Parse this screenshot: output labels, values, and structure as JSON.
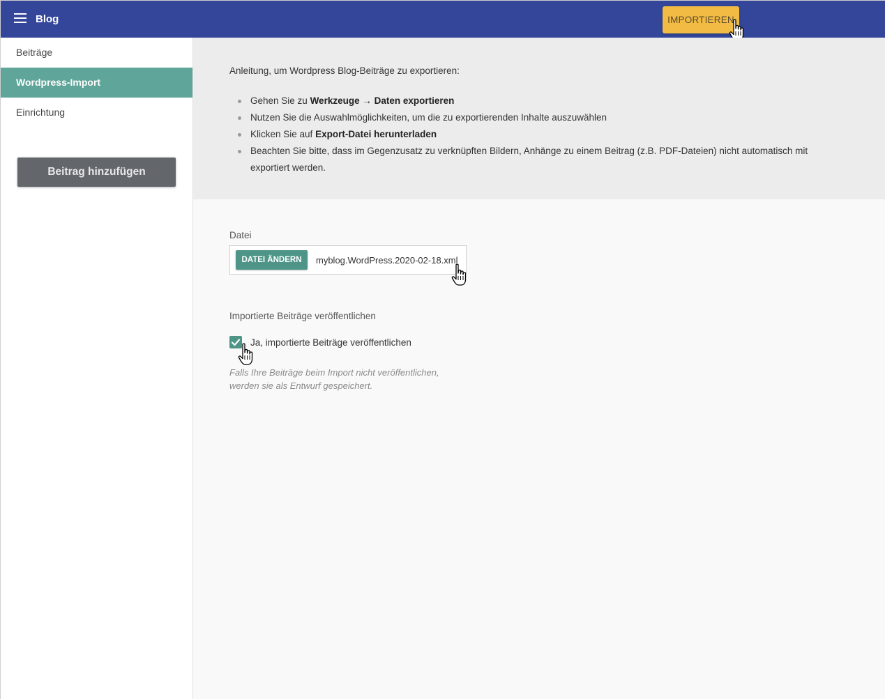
{
  "header": {
    "title": "Blog",
    "import_label": "IMPORTIEREN"
  },
  "sidebar": {
    "items": [
      {
        "label": "Beiträge"
      },
      {
        "label": "Wordpress-Import"
      },
      {
        "label": "Einrichtung"
      }
    ],
    "add_post_label": "Beitrag hinzufügen"
  },
  "instructions": {
    "intro": "Anleitung, um Wordpress Blog-Beiträge zu exportieren:",
    "step1_pre": "Gehen Sie zu ",
    "step1_bold": "Werkzeuge → Daten exportieren",
    "step2": "Nutzen Sie die Auswahlmöglichkeiten, um die zu exportierenden Inhalte auszuwählen",
    "step3_pre": "Klicken Sie auf ",
    "step3_bold": "Export-Datei herunterladen",
    "step4": "Beachten Sie bitte, dass im Gegenzusatz zu verknüpften Bildern, Anhänge zu einem Beitrag (z.B. PDF-Dateien) nicht automatisch mit exportiert werden."
  },
  "file_field": {
    "label": "Datei",
    "button_label": "DATEI ÄNDERN",
    "file_name": "myblog.WordPress.2020-02-18.xml"
  },
  "publish_field": {
    "label": "Importierte Beiträge veröffentlichen",
    "checkbox_label": "Ja, importierte Beiträge veröffentlichen",
    "checked": true,
    "hint": "Falls Ihre Beiträge beim Import nicht veröffentlichen, werden sie als Entwurf gespeichert."
  },
  "colors": {
    "topbar": "#33469a",
    "accent": "#5fa59a",
    "import_button": "#f2bc44"
  }
}
